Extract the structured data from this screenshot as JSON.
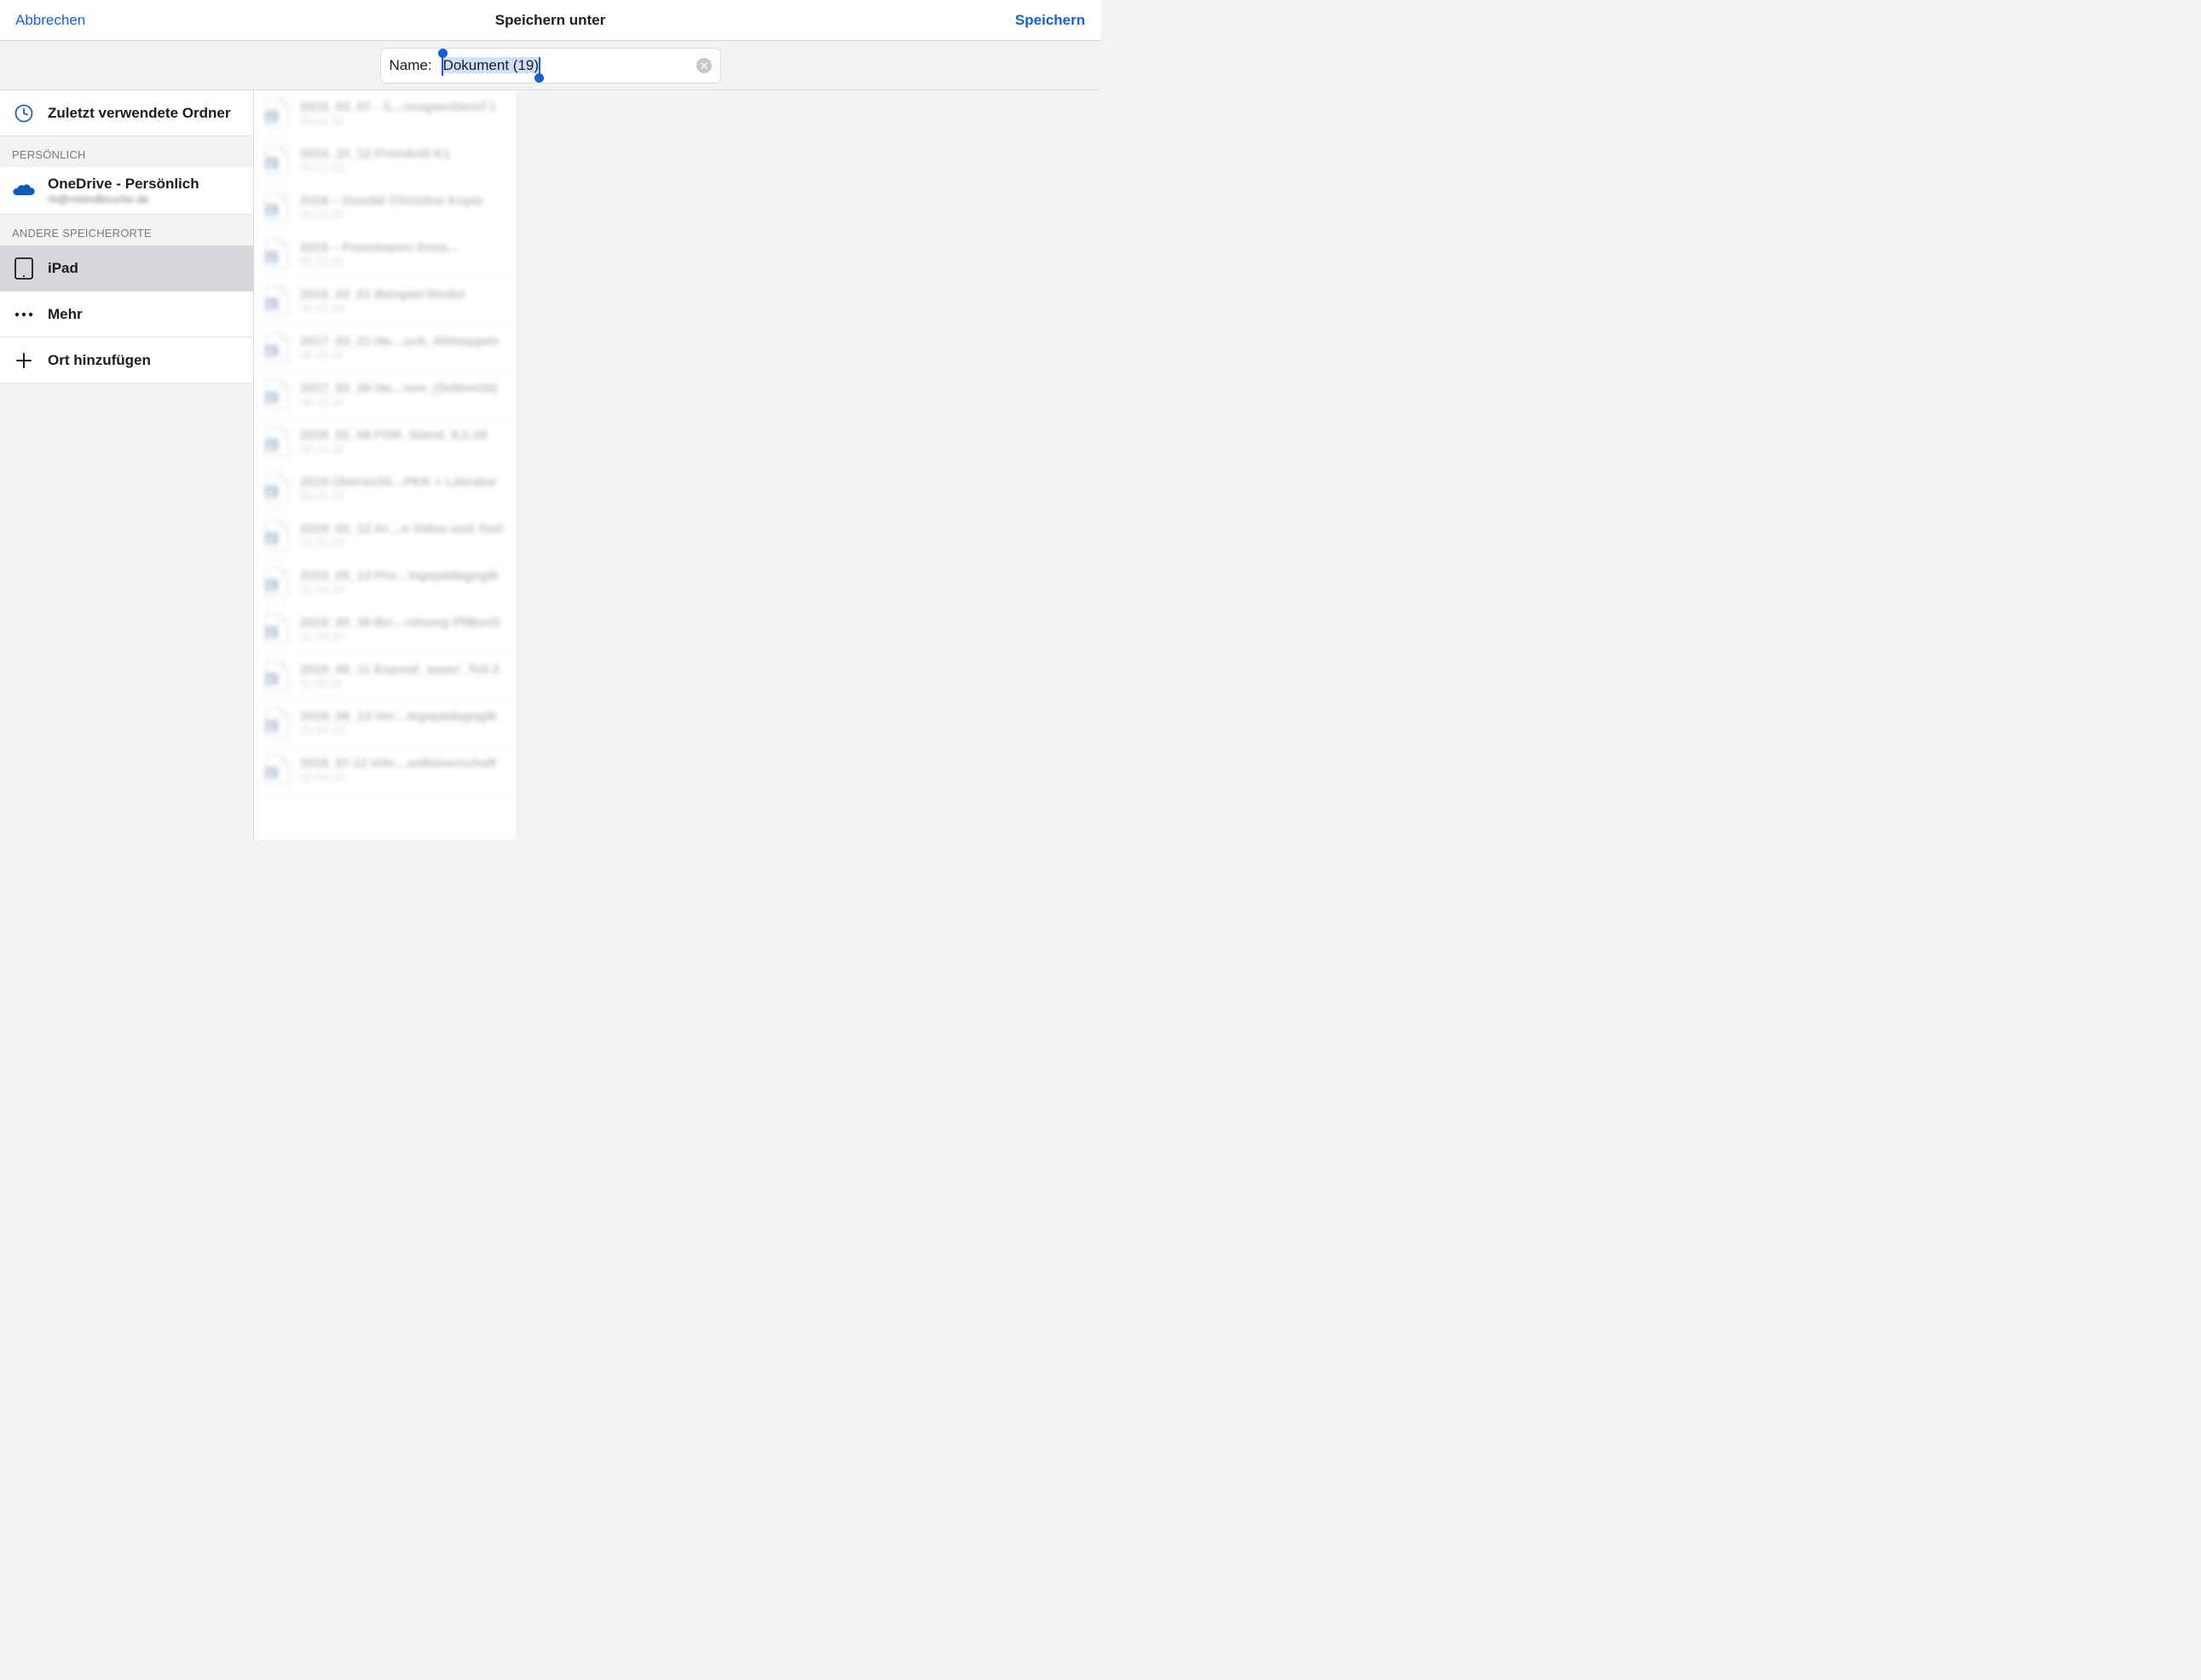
{
  "header": {
    "cancel": "Abbrechen",
    "title": "Speichern unter",
    "save": "Speichern"
  },
  "nameField": {
    "label": "Name:",
    "value": "Dokument (19)"
  },
  "sidebar": {
    "recent": "Zuletzt verwendete Ordner",
    "section_personal": "PERSÖNLICH",
    "onedrive_title": "OneDrive - Persönlich",
    "onedrive_sub": "rb@rolandbruche.de",
    "section_other": "ANDERE SPEICHERORTE",
    "ipad": "iPad",
    "more": "Mehr",
    "add_location": "Ort hinzufügen"
  },
  "files": [
    {
      "name": "2015_03_07 - S…rungsentwurf 1",
      "date": "06.12.18"
    },
    {
      "name": "2015_10_12 Protokoll K1",
      "date": "06.12.18"
    },
    {
      "name": "2016 – Dusdal Christine Kopie",
      "date": "05.12.18"
    },
    {
      "name": "2016 – Ponomarev Anna…",
      "date": "05.12.18"
    },
    {
      "name": "2016_03_01 Beispiel Modul",
      "date": "05.12.18"
    },
    {
      "name": "2017_02_21 Ha…uck_Altmappen",
      "date": "08.12.18"
    },
    {
      "name": "2017_02_26 Ha…nen_(Seltrecht)",
      "date": "08.12.18"
    },
    {
      "name": "2018_02_08 FOR_Stand_8.2.18",
      "date": "08.12.18"
    },
    {
      "name": "2019 Übersicht…PKK + Literatur",
      "date": "03.02.19"
    },
    {
      "name": "2019_02_12 Ar…n Video und Text",
      "date": "21.02.19"
    },
    {
      "name": "2019_05_13 Pro…legepädagogik",
      "date": "21.04.19"
    },
    {
      "name": "2019_05_30 Bri…rdnung PflBerG",
      "date": "21.04.19"
    },
    {
      "name": "2019_06_11 Exposé_sauer_Teil 2",
      "date": "11.06.19"
    },
    {
      "name": "2019_06_13 Ver…legepädagogik",
      "date": "21.04.19"
    },
    {
      "name": "2019_07.12 Info…asthörerschaft",
      "date": "22.04.19"
    }
  ]
}
